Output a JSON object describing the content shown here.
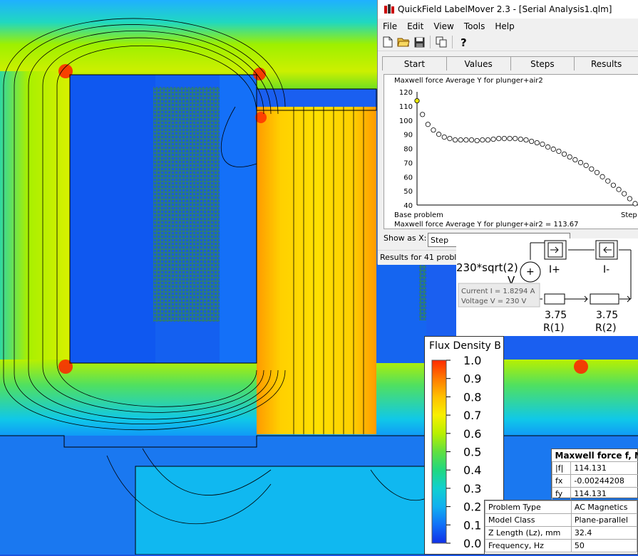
{
  "app": {
    "title": "QuickField LabelMover 2.3 - [Serial Analysis1.qlm]",
    "menu": [
      "File",
      "Edit",
      "View",
      "Tools",
      "Help"
    ],
    "toolbar_icons": [
      "new-file-icon",
      "open-folder-icon",
      "save-icon",
      "copy-icon",
      "help-icon"
    ],
    "tabs": [
      "Start",
      "Values",
      "Steps",
      "Results"
    ],
    "show_as_label": "Show as X:",
    "show_as_value": "Step",
    "status": "Results for 41 proble"
  },
  "chart_data": {
    "type": "scatter",
    "title": "Maxwell force Average Y for plunger+air2",
    "xlabel_left": "Base problem",
    "xlabel_right": "Step",
    "footer": "Maxwell force Average Y for plunger+air2 = 113.67",
    "ylim": [
      40,
      120
    ],
    "yticks": [
      40,
      50,
      60,
      70,
      80,
      90,
      100,
      110,
      120
    ],
    "x": [
      0,
      1,
      2,
      3,
      4,
      5,
      6,
      7,
      8,
      9,
      10,
      11,
      12,
      13,
      14,
      15,
      16,
      17,
      18,
      19,
      20,
      21,
      22,
      23,
      24,
      25,
      26,
      27,
      28,
      29,
      30,
      31,
      32,
      33,
      34,
      35,
      36,
      37,
      38,
      39,
      40
    ],
    "values": [
      113.67,
      104,
      97,
      93,
      90,
      88,
      87,
      86,
      86,
      86,
      86,
      85.5,
      86,
      86,
      86.5,
      87,
      87,
      87,
      87,
      86.5,
      86,
      85,
      84,
      83,
      81,
      79.5,
      78,
      76,
      74,
      72,
      70,
      68,
      65.5,
      63,
      60,
      57,
      54,
      51,
      48,
      44.5,
      41
    ],
    "highlight_index": 0,
    "colors": {
      "highlight": "#e8e800",
      "point": "#ffffff"
    }
  },
  "circuit": {
    "source_value": "230*sqrt(2)",
    "source_unit": "V",
    "current_readout": "Current I = 1.8294 A",
    "voltage_readout": "Voltage V = 230 V",
    "terminal_plus": "I+",
    "terminal_minus": "I-",
    "r1_value": "3.75",
    "r1_name": "R(1)",
    "r2_value": "3.75",
    "r2_name": "R(2)"
  },
  "legend": {
    "title": "Flux Density B",
    "ticks": [
      "1.0",
      "0.9",
      "0.8",
      "0.7",
      "0.6",
      "0.5",
      "0.4",
      "0.3",
      "0.2",
      "0.1",
      "0.0"
    ]
  },
  "force_table": {
    "title": "Maxwell force f, N",
    "rows": [
      {
        "label": "|f|",
        "value": "114.131"
      },
      {
        "label": "fx",
        "value": "-0.00244208"
      },
      {
        "label": "fy",
        "value": "114.131"
      }
    ]
  },
  "props_table": [
    {
      "label": "Problem Type",
      "value": "AC Magnetics"
    },
    {
      "label": "Model Class",
      "value": "Plane-parallel"
    },
    {
      "label": "Z Length (Lz), mm",
      "value": "32.4"
    },
    {
      "label": "Frequency, Hz",
      "value": "50"
    }
  ]
}
